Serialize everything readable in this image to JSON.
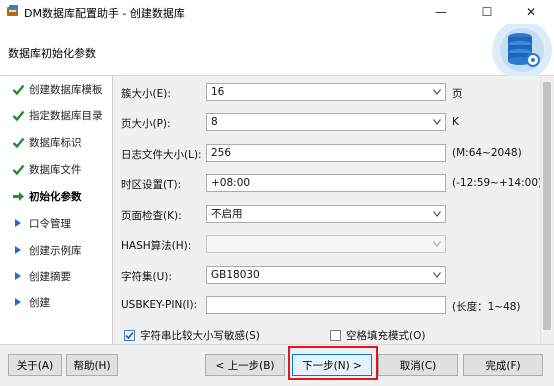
{
  "window": {
    "title": "DM数据库配置助手 - 创建数据库",
    "minimize_glyph": "—",
    "maximize_glyph": "☐",
    "close_glyph": "✕"
  },
  "header": {
    "title": "数据库初始化参数"
  },
  "nav": {
    "items": [
      {
        "label": "创建数据库模板",
        "state": "done"
      },
      {
        "label": "指定数据库目录",
        "state": "done"
      },
      {
        "label": "数据库标识",
        "state": "done"
      },
      {
        "label": "数据库文件",
        "state": "done"
      },
      {
        "label": "初始化参数",
        "state": "current"
      },
      {
        "label": "口令管理",
        "state": "pending"
      },
      {
        "label": "创建示例库",
        "state": "pending"
      },
      {
        "label": "创建摘要",
        "state": "pending"
      },
      {
        "label": "创建",
        "state": "pending"
      }
    ]
  },
  "form": {
    "extent_size": {
      "label": "簇大小(E):",
      "value": "16",
      "unit": "页"
    },
    "page_size": {
      "label": "页大小(P):",
      "value": "8",
      "unit": "K"
    },
    "log_size": {
      "label": "日志文件大小(L):",
      "value": "256",
      "hint": "(M:64~2048)"
    },
    "time_zone": {
      "label": "时区设置(T):",
      "value": "+08:00",
      "hint": "(-12:59~+14:00)"
    },
    "page_check": {
      "label": "页面检查(K):",
      "value": "不启用"
    },
    "hash_algo": {
      "label": "HASH算法(H):",
      "value": ""
    },
    "charset": {
      "label": "字符集(U):",
      "value": "GB18030"
    },
    "usbkey_pin": {
      "label": "USBKEY-PIN(I):",
      "value": "",
      "hint": "(长度：1~48)"
    },
    "case_sensitive": {
      "label": "字符串比较大小写敏感(S)",
      "checked": true
    },
    "blank_pad": {
      "label": "空格填充模式(O)",
      "checked": false
    }
  },
  "footer": {
    "about": "关于(A)",
    "help": "帮助(H)",
    "back": "< 上一步(B)",
    "next": "下一步(N) >",
    "cancel": "取消(C)",
    "finish": "完成(F)"
  },
  "colors": {
    "check_green": "#1f8f2f",
    "arrow_blue": "#1e6fc9",
    "highlight": "#e2141c"
  }
}
